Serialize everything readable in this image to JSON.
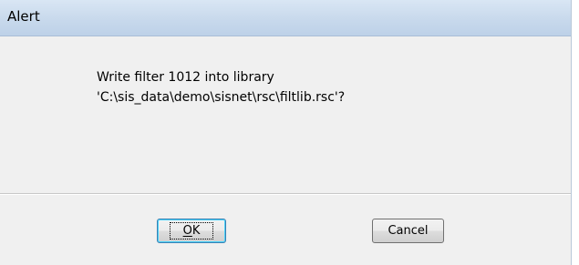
{
  "window": {
    "title": "Alert"
  },
  "message": {
    "line1": "Write filter 1012 into library",
    "line2": "'C:\\sis_data\\demo\\sisnet\\rsc\\filtlib.rsc'?"
  },
  "buttons": {
    "ok_label": "OK",
    "ok_mnemonic": "O",
    "ok_rest": "K",
    "cancel_label": "Cancel"
  }
}
